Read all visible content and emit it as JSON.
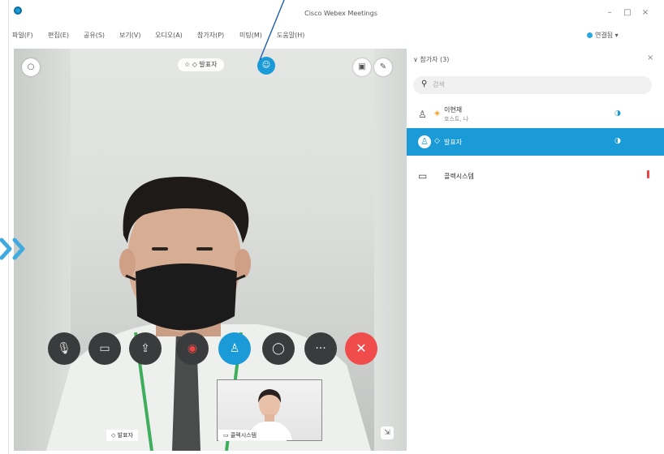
{
  "app": {
    "title": "Cisco Webex Meetings",
    "window_controls": {
      "minimize": "–",
      "maximize": "□",
      "close": "×"
    }
  },
  "menu": {
    "items": [
      "파일(F)",
      "편집(E)",
      "공유(S)",
      "보기(V)",
      "오디오(A)",
      "참가자(P)",
      "미팅(M)",
      "도움말(H)"
    ],
    "connection_status": "연결됨 ▾"
  },
  "stage": {
    "active_speaker_label": "☆ ◇ 발표자",
    "controls": [
      {
        "name": "mute-button",
        "icon": "mic-muted-icon",
        "glyph": "🎙"
      },
      {
        "name": "video-button",
        "icon": "camera-icon",
        "glyph": "▭"
      },
      {
        "name": "share-button",
        "icon": "share-icon",
        "glyph": "⇪"
      },
      {
        "name": "record-button",
        "icon": "record-icon",
        "glyph": "◉"
      },
      {
        "name": "participants-button",
        "icon": "person-icon",
        "glyph": "♙"
      },
      {
        "name": "chat-button",
        "icon": "chat-icon",
        "glyph": "◯"
      },
      {
        "name": "more-button",
        "icon": "more-icon",
        "glyph": "···"
      },
      {
        "name": "end-call-button",
        "icon": "close-icon",
        "glyph": "✕"
      }
    ],
    "name_tags": {
      "main": "◇ 발표자",
      "self": "▭ 콜렉시스템"
    }
  },
  "participants": {
    "header": "∨ 참가자 (3)",
    "search_placeholder": "검색",
    "list": [
      {
        "name": "이현재",
        "role": "호스트, 나",
        "selected": false
      },
      {
        "name": "발표자",
        "role": "",
        "selected": true
      },
      {
        "name": "콜렉시스템",
        "role": "",
        "selected": false
      }
    ]
  },
  "colors": {
    "accent": "#1a9ad6",
    "danger": "#f04c4c",
    "control_bg": "#3a3b3c",
    "annotation_arrow": "#1c5fae"
  }
}
